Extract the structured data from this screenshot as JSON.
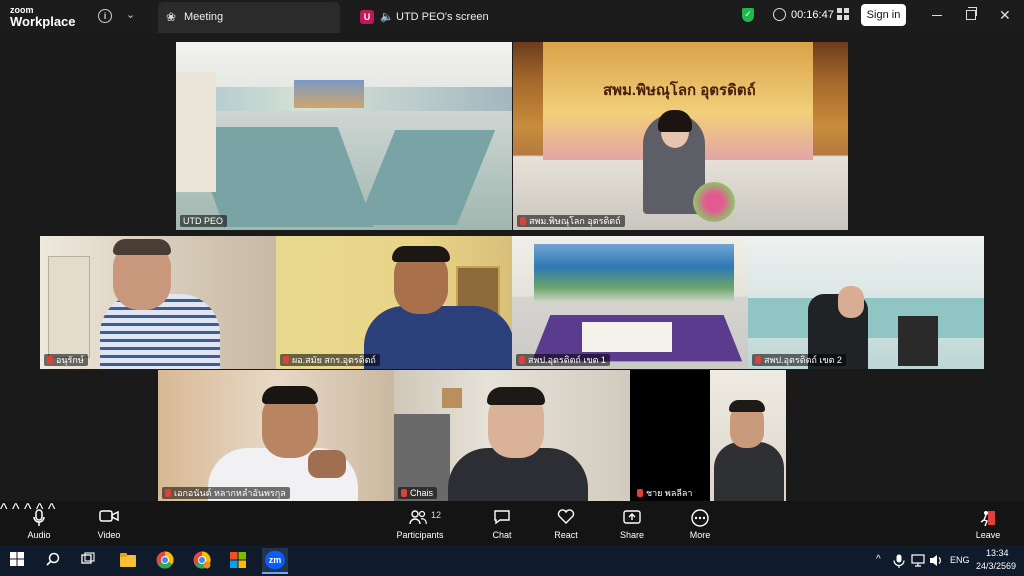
{
  "app": {
    "logo_line1": "zoom",
    "logo_line2": "Workplace"
  },
  "tabs": [
    {
      "label": "Meeting"
    },
    {
      "label": "UTD PEO's screen",
      "badge": "U"
    }
  ],
  "header": {
    "timer": "00:16:47",
    "signin_label": "Sign in"
  },
  "participants": [
    {
      "name": "UTD PEO"
    },
    {
      "name": "สพม.พิษณุโลก อุตรดิตถ์"
    },
    {
      "name": "อนุรักษ์"
    },
    {
      "name": "ผอ.สมัย  สกร.อุตรดิตถ์"
    },
    {
      "name": "สพป.อุตรดิตถ์ เขต 1"
    },
    {
      "name": "สพป.อุตรดิตถ์ เขต 2"
    },
    {
      "name": "เอกอนันต์ หลากหลำอันพรกุล"
    },
    {
      "name": "Chais"
    },
    {
      "name": "ชาย พลลีลา"
    }
  ],
  "banner_text": "สพม.พิษณุโลก อุตรดิตถ์",
  "toolbar": {
    "audio": "Audio",
    "video": "Video",
    "participants": "Participants",
    "participants_count": "12",
    "chat": "Chat",
    "react": "React",
    "share": "Share",
    "more": "More",
    "leave": "Leave"
  },
  "taskbar": {
    "lang": "ENG",
    "time": "13:34",
    "date": "24/3/2569",
    "zoom_label": "zm"
  },
  "colors": {
    "accent_green": "#2ecc71",
    "mute_red": "#e0403a",
    "zoom_blue": "#0b5cff",
    "shield_green": "#1fb84b"
  }
}
